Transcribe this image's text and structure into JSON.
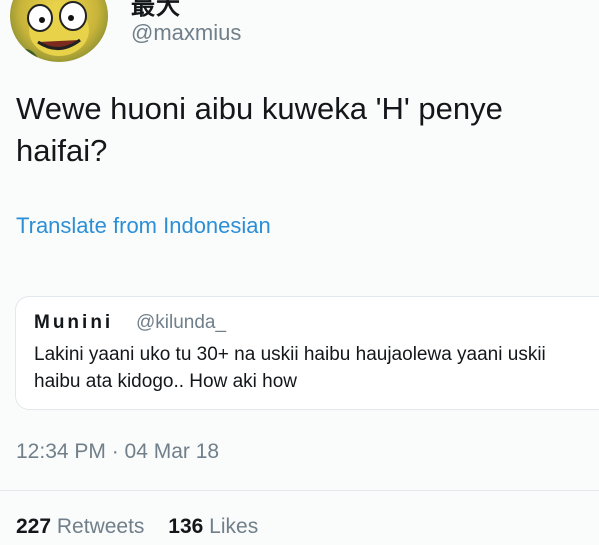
{
  "author": {
    "display_name": "最大",
    "handle": "@maxmius"
  },
  "tweet": {
    "text": "Wewe huoni aibu kuweka 'H' penye haifai?",
    "translate_label": "Translate from Indonesian",
    "timestamp": "12:34 PM · 04 Mar 18"
  },
  "quoted_tweet": {
    "display_name": "Munini",
    "handle": "@kilunda_",
    "text": "Lakini yaani uko tu 30+ na uskii haibu haujaolewa yaani uskii haibu ata kidogo.. How aki how"
  },
  "stats": {
    "retweets_count": "227",
    "retweets_label": "Retweets",
    "likes_count": "136",
    "likes_label": "Likes"
  },
  "colors": {
    "link": "#2c8fd6",
    "muted": "#707f8a",
    "text": "#14171a",
    "border": "#e3e8ec"
  }
}
